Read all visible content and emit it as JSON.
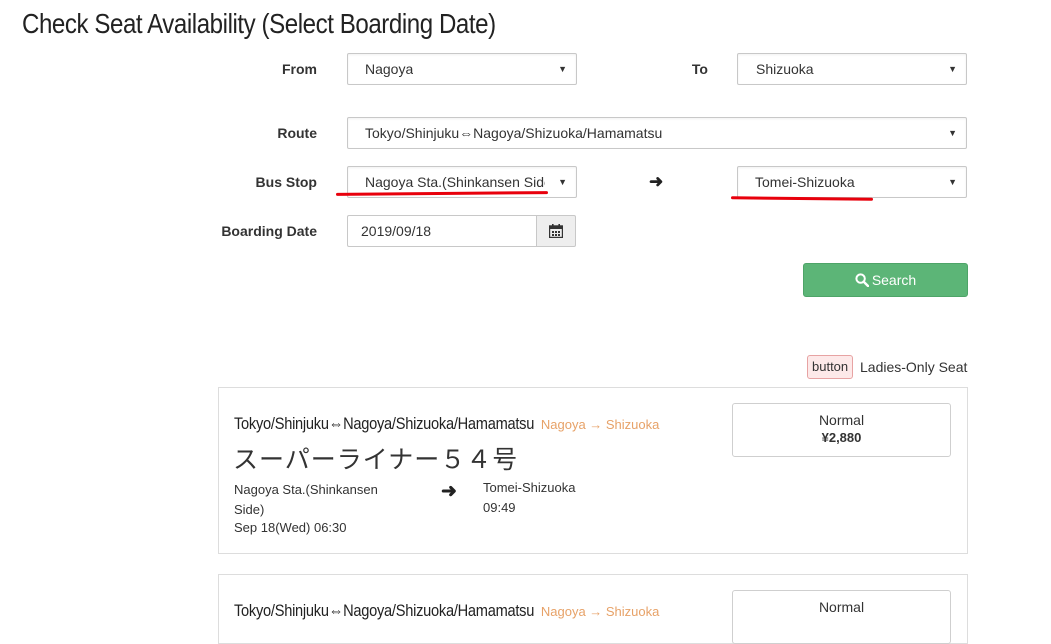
{
  "page_title": "Check Seat Availability (Select Boarding Date)",
  "form": {
    "from": {
      "label": "From",
      "value": "Nagoya"
    },
    "to": {
      "label": "To",
      "value": "Shizuoka"
    },
    "route": {
      "label": "Route",
      "value": "Tokyo/Shinjuku⇔Nagoya/Shizuoka/Hamamatsu"
    },
    "bus_stop": {
      "label": "Bus Stop",
      "from_value": "Nagoya Sta.(Shinkansen Side)",
      "to_value": "Tomei-Shizuoka",
      "arrow_icon": "right-arrow-icon"
    },
    "boarding_date": {
      "label": "Boarding Date",
      "value": "2019/09/18",
      "icon": "calendar-icon"
    },
    "search_button": {
      "label": "Search",
      "icon": "search-icon",
      "color": "#5cb577"
    },
    "annotation_color": "#e8000c"
  },
  "legend": {
    "badge": "button",
    "text": "Ladies-Only Seat",
    "badge_color": "#fde9e9"
  },
  "results": [
    {
      "route": "Tokyo/Shinjuku⇔Nagoya/Shizuoka/Hamamatsu",
      "od": "Nagoya → Shizuoka",
      "bus_name": "スーパーライナー５４号",
      "departure_stop": "Nagoya Sta.(Shinkansen Side)",
      "departure_time": "Sep 18(Wed) 06:30",
      "arrival_stop": "Tomei-Shizuoka",
      "arrival_time": "09:49",
      "fare_class": "Normal",
      "fare_price": "¥2,880"
    },
    {
      "route": "Tokyo/Shinjuku⇔Nagoya/Shizuoka/Hamamatsu",
      "od": "Nagoya → Shizuoka",
      "fare_class": "Normal"
    }
  ],
  "colors": {
    "od_text": "#e7a268",
    "card_border": "#dddddd"
  }
}
